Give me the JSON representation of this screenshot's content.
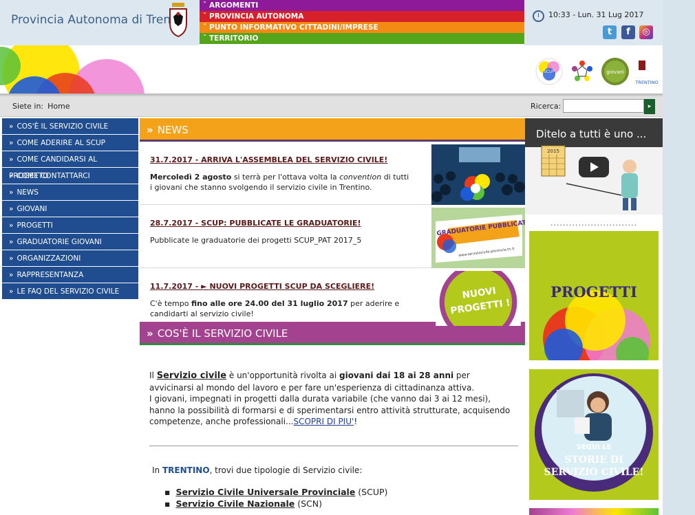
{
  "brand": {
    "name": "Provincia Autonoma di Trento"
  },
  "topnav": [
    {
      "label": "ARGOMENTI",
      "color": "#8e1a9a"
    },
    {
      "label": "PROVINCIA AUTONOMA",
      "color": "#d7212a"
    },
    {
      "label": "PUNTO INFORMATIVO CITTADINI/IMPRESE",
      "color": "#f28a14"
    },
    {
      "label": "TERRITORIO",
      "color": "#55a51c"
    }
  ],
  "clock": {
    "text": "10:33 - Lun. 31 Lug 2017"
  },
  "social": [
    {
      "name": "twitter-icon",
      "glyph": "t",
      "color": "#4a9bd4"
    },
    {
      "name": "facebook-icon",
      "glyph": "f",
      "color": "#3b5998"
    },
    {
      "name": "instagram-icon",
      "glyph": "◎",
      "color": "#c1367a"
    }
  ],
  "breadcrumb": {
    "prefix": "Siete in:",
    "home": "Home"
  },
  "search": {
    "label": "Ricerca:",
    "placeholder": "",
    "button": "▸"
  },
  "sidebar": {
    "items": [
      "COS'È IL SERVIZIO CIVILE",
      "COME ADERIRE AL SCUP",
      "COME CANDIDARSI AL PROGETTO",
      "COME CONTATTARCI",
      "NEWS",
      "GIOVANI",
      "PROGETTI",
      "GRADUATORIE GIOVANI",
      "ORGANIZZAZIONI",
      "RAPPRESENTANZA",
      "LE FAQ DEL SERVIZIO CIVILE"
    ]
  },
  "news": {
    "heading": "NEWS",
    "items": [
      {
        "title": "31.7.2017 - ARRIVA L'ASSEMBLEA DEL SERVIZIO CIVILE!",
        "text_a": "Mercoledì 2 agosto",
        "text_b": " si terrà per l'ottava volta la ",
        "text_c": "convention",
        "text_d": " di tutti i giovani che stanno svolgendo il servizio civile in Trentino."
      },
      {
        "title": "28.7.2017 - SCUP: PUBBLICATE LE GRADUATORIE!",
        "text": "Pubblicate le graduatorie dei progetti SCUP_PAT 2017_5",
        "img_text": "GRADUATORIE PUBBLICATE",
        "img_url": "www.serviziocivile.provincia.tn.it"
      },
      {
        "title": "11.7.2017 - ► NUOVI PROGETTI SCUP DA SCEGLIERE!",
        "text_a": "C'è tempo ",
        "text_b": "fino alle ore 24.00 del 31 luglio 2017",
        "text_c": " per aderire e candidarti al servizio civile!",
        "img_text_1": "NUOVI",
        "img_text_2": "PROGETTI !"
      }
    ]
  },
  "civile": {
    "heading": "COS'È IL SERVIZIO CIVILE",
    "p1_a": "Il ",
    "p1_link": "Servizio civile",
    "p1_b": " è un'opportunità rivolta ai ",
    "p1_bold": "giovani dai 18 ai 28 anni",
    "p1_c": " per avvicinarsi al mondo del lavoro e per fare un'esperienza di cittadinanza attiva.",
    "p2": "I giovani, impegnati in progetti dalla durata variabile (che vanno dai 3 ai 12 mesi), hanno la possibilità di formarsi e di sperimentarsi entro attività strutturate, acquisendo competenze, anche professionali...",
    "p2_link": "SCOPRI DI PIU'",
    "p2_end": "!",
    "trentino_a": "In ",
    "trentino_b": "TRENTINO",
    "trentino_c": ", trovi due tipologie di Servizio civile:",
    "types": [
      {
        "name": "Servizio Civile Universale Provinciale",
        "abbr": " (SCUP)"
      },
      {
        "name": "Servizio Civile Nazionale",
        "abbr": " (SCN)"
      }
    ]
  },
  "right": {
    "video_title": "Ditelo a tutti è uno ...",
    "video_calendar": "2015",
    "dots": "............................",
    "progetti": "PROGETTI",
    "segui_1": "SEGUI LE",
    "segui_2": "STORIE DI",
    "segui_3": "SERVIZIO CIVILE!"
  },
  "logos": {
    "scup": "SCUP",
    "giovani": "giovani",
    "trentino": "TRENTINO"
  },
  "colors": {
    "nav_blue": "#1f4d8f",
    "news_orange": "#f5a21b",
    "civile_purple": "#a3438f",
    "brand_blue": "#3b5f86"
  }
}
